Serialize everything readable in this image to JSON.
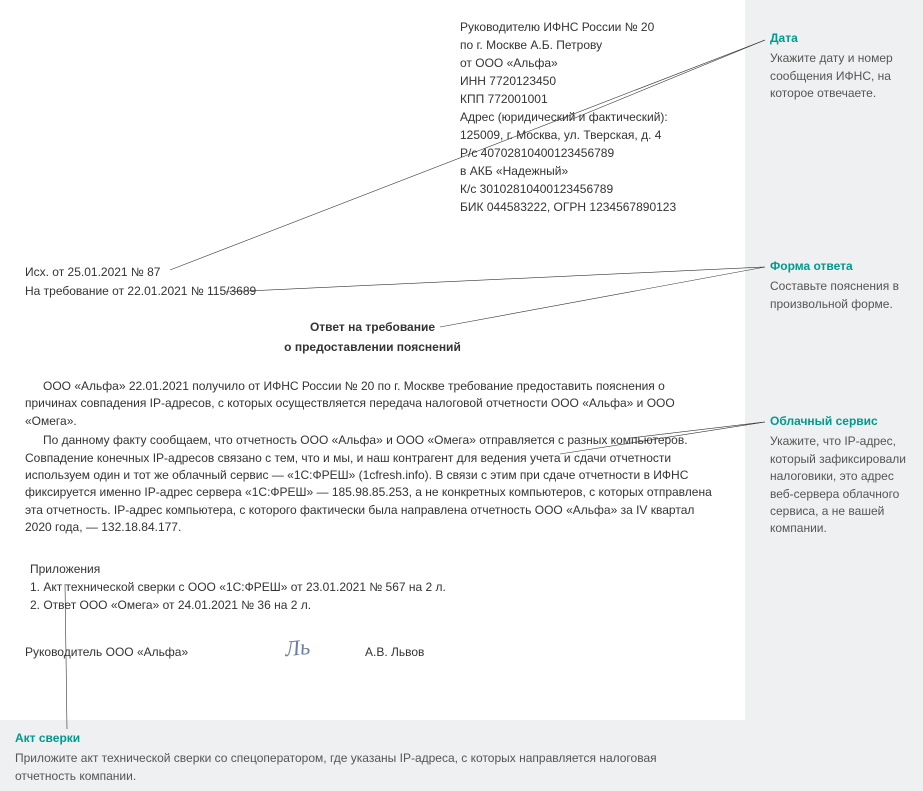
{
  "header": {
    "l1": "Руководителю ИФНС России № 20",
    "l2": "по г. Москве А.Б. Петрову",
    "l3": "от ООО «Альфа»",
    "l4": "ИНН 7720123450",
    "l5": "КПП 772001001",
    "l6": "Адрес (юридический и фактический):",
    "l7": "125009, г. Москва, ул. Тверская, д. 4",
    "l8": "Р/с 40702810400123456789",
    "l9": "в АКБ «Надежный»",
    "l10": "К/с 30102810400123456789",
    "l11": "БИК 044583222, ОГРН 1234567890123"
  },
  "meta": {
    "outgoing": "Исх. от 25.01.2021 № 87",
    "ref": "На требование от 22.01.2021 № 115/3689"
  },
  "title": {
    "l1": "Ответ на требование",
    "l2": "о предоставлении пояснений"
  },
  "body": {
    "p1": "ООО «Альфа» 22.01.2021 получило от ИФНС России № 20 по г. Москве требование предоставить пояснения о причинах совпадения IP-адресов, с которых осуществляется передача налоговой отчетности ООО «Альфа» и ООО «Омега».",
    "p2": "По данному факту сообщаем, что отчетность ООО «Альфа» и ООО «Омега» отправляется с разных компьютеров. Совпадение конечных IP-адресов связано с тем, что и мы, и наш контрагент для ведения учета и сдачи отчетности используем один и тот же облачный сервис — «1С:ФРЕШ» (1cfresh.info). В связи с этим при сдаче отчетности в ИФНС фиксируется именно IP-адрес сервера «1С:ФРЕШ» — 185.98.85.253, а не конкретных компьютеров, с которых отправлена эта отчетность. IP-адрес компьютера, с которого фактически была направлена отчетность ООО «Альфа» за IV квартал 2020 года, — 132.18.84.177."
  },
  "attachments": {
    "title": "Приложения",
    "i1": "1. Акт технической сверки с ООО «1С:ФРЕШ» от 23.01.2021 № 567 на 2 л.",
    "i2": "2. Ответ ООО «Омега» от 24.01.2021 № 36 на 2 л."
  },
  "signature": {
    "role": "Руководитель ООО «Альфа»",
    "mark": "Ль",
    "name": "А.В. Львов"
  },
  "annotations": {
    "date": {
      "title": "Дата",
      "text": "Укажите дату и номер сообщения ИФНС, на которое отвечаете."
    },
    "form": {
      "title": "Форма ответа",
      "text": "Составьте пояснения в произвольной форме."
    },
    "cloud": {
      "title": "Облачный сервис",
      "text": "Укажите, что IP-адрес, который зафиксировали налоговики, это адрес веб-сервера облачного сервиса, а не вашей компании."
    },
    "akt": {
      "title": "Акт сверки",
      "text": "Приложите акт технической сверки со спецоператором, где указаны IP-адреса, с которых направляется налоговая отчетность компании."
    }
  }
}
